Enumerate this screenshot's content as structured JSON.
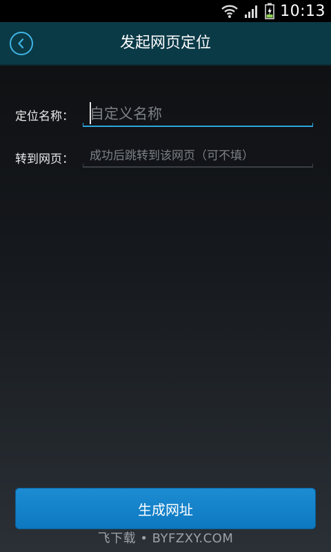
{
  "status_bar": {
    "time": "10:13",
    "icons": [
      "wifi-icon",
      "signal-icon",
      "battery-charging-icon"
    ]
  },
  "header": {
    "title": "发起网页定位",
    "back_icon": "chevron-left-icon",
    "accent_color": "#3fb6e6"
  },
  "form": {
    "name": {
      "label": "定位名称：",
      "value": "",
      "placeholder": "自定义名称"
    },
    "redirect": {
      "label": "转到网页：",
      "value": "",
      "placeholder": "成功后跳转到该网页（可不填）"
    }
  },
  "actions": {
    "generate_label": "生成网址",
    "button_color": "#1582c8"
  },
  "watermark": "飞下载 • BYFZXY.COM"
}
